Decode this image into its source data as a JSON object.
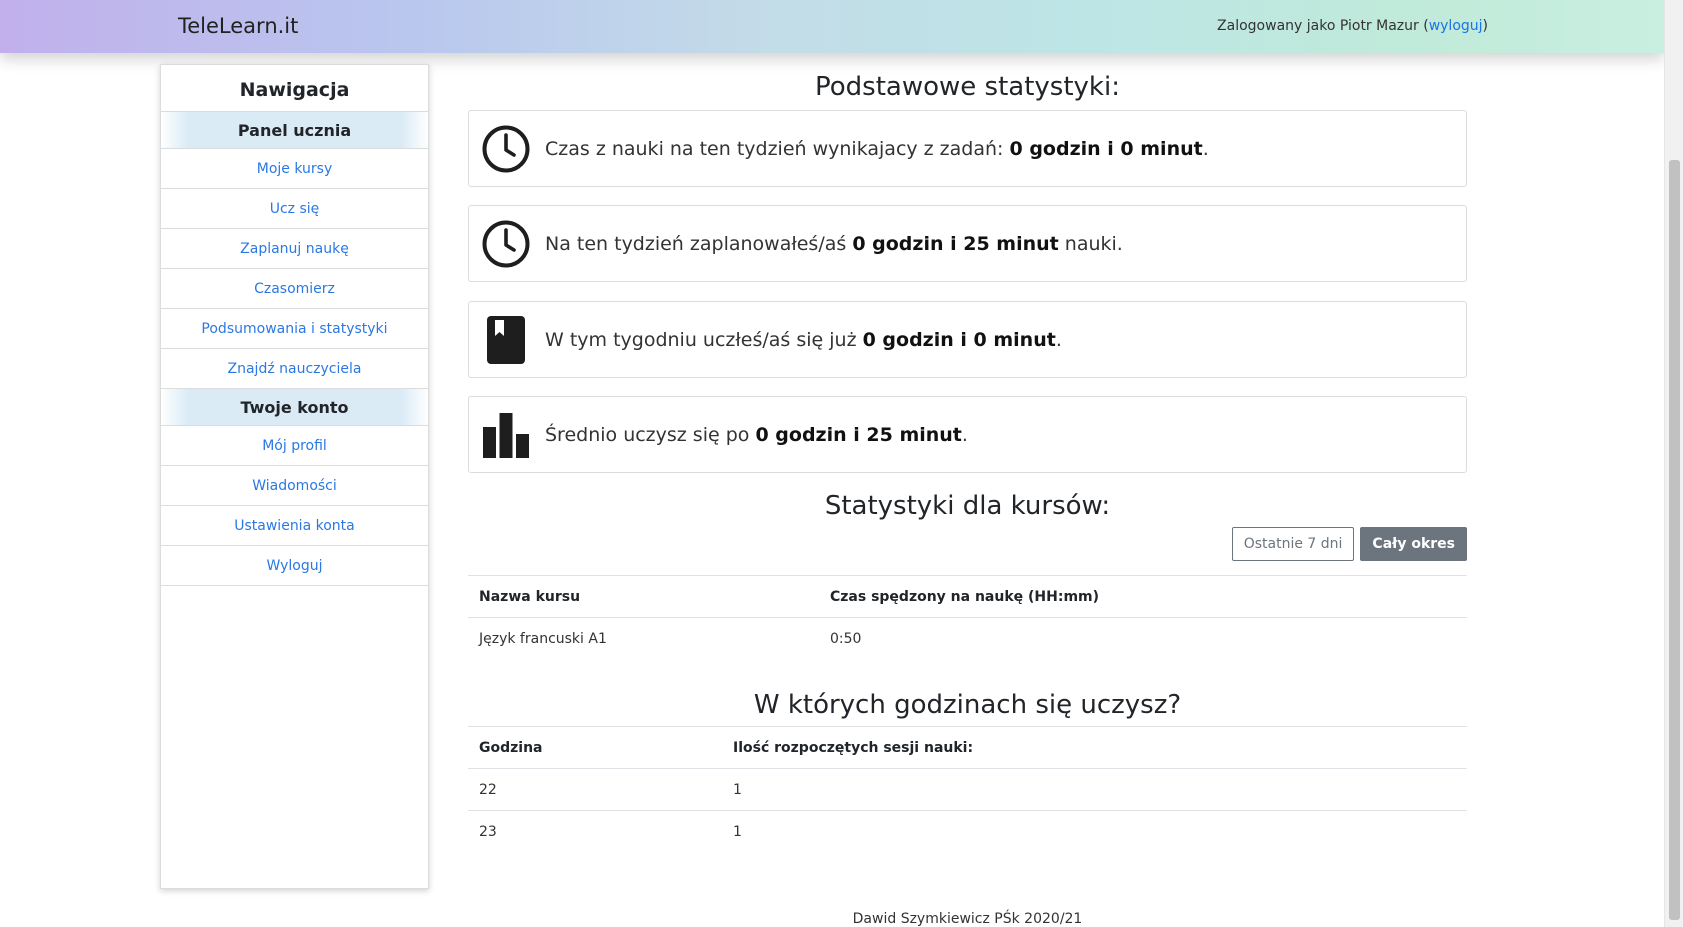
{
  "header": {
    "brand": "TeleLearn.it",
    "logged_prefix": "Zalogowany jako Piotr Mazur (",
    "logout_link": "wyloguj",
    "logged_suffix": ")"
  },
  "sidebar": {
    "title": "Nawigacja",
    "section_student": "Panel ucznia",
    "student_items": [
      "Moje kursy",
      "Ucz się",
      "Zaplanuj naukę",
      "Czasomierz",
      "Podsumowania i statystyki",
      "Znajdź nauczyciela"
    ],
    "section_account": "Twoje konto",
    "account_items": [
      "Mój profil",
      "Wiadomości",
      "Ustawienia konta",
      "Wyloguj"
    ]
  },
  "basic_stats": {
    "heading": "Podstawowe statystyki:",
    "cards": [
      {
        "icon": "clock-icon",
        "prefix": "Czas z nauki na ten tydzień wynikajacy z zadań: ",
        "bold": "0 godzin i 0 minut",
        "suffix": "."
      },
      {
        "icon": "clock-icon",
        "prefix": "Na ten tydzień zaplanowałeś/aś ",
        "bold": "0 godzin i 25 minut",
        "suffix": " nauki."
      },
      {
        "icon": "bookmark-book-icon",
        "prefix": "W tym tygodniu uczłeś/aś się już ",
        "bold": "0 godzin i 0 minut",
        "suffix": "."
      },
      {
        "icon": "bar-chart-icon",
        "prefix": "Średnio uczysz się po ",
        "bold": "0 godzin i 25 minut",
        "suffix": "."
      }
    ]
  },
  "course_stats": {
    "heading": "Statystyki dla kursów:",
    "btn_last7": "Ostatnie 7 dni",
    "btn_all": "Cały okres",
    "columns": [
      "Nazwa kursu",
      "Czas spędzony na naukę (HH:mm)"
    ],
    "rows": [
      [
        "Język francuski A1",
        "0:50"
      ]
    ]
  },
  "hour_stats": {
    "heading": "W których godzinach się uczysz?",
    "columns": [
      "Godzina",
      "Ilość rozpoczętych sesji nauki:"
    ],
    "rows": [
      [
        "22",
        "1"
      ],
      [
        "23",
        "1"
      ]
    ]
  },
  "footer": {
    "text": "Dawid Szymkiewicz PŚk 2020/21"
  }
}
